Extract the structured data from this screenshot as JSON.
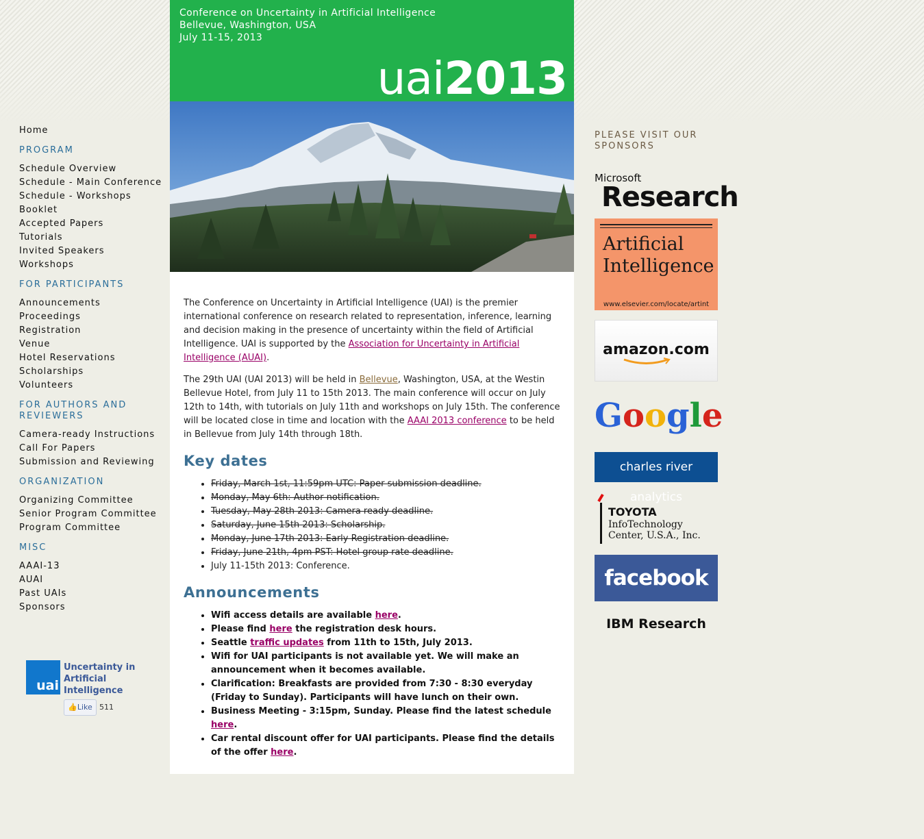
{
  "header": {
    "line1": "Conference on Uncertainty in Artificial Intelligence",
    "line2": "Bellevue, Washington, USA",
    "line3": "July 11-15, 2013",
    "logo_uai": "uai",
    "logo_year": "2013"
  },
  "nav": {
    "home": "Home",
    "program_head": "PROGRAM",
    "program_items": [
      "Schedule Overview",
      "Schedule - Main Conference",
      "Schedule - Workshops",
      "Booklet",
      "Accepted Papers",
      "Tutorials",
      "Invited Speakers",
      "Workshops"
    ],
    "participants_head": "FOR PARTICIPANTS",
    "participants_items": [
      "Announcements",
      "Proceedings",
      "Registration",
      "Venue",
      "Hotel Reservations",
      "Scholarships",
      "Volunteers"
    ],
    "authors_head": "FOR AUTHORS AND REVIEWERS",
    "authors_items": [
      "Camera-ready Instructions",
      "Call For Papers",
      "Submission and Reviewing"
    ],
    "organization_head": "ORGANIZATION",
    "organization_items": [
      "Organizing Committee",
      "Senior Program Committee",
      "Program Committee"
    ],
    "misc_head": "MISC",
    "misc_items": [
      "AAAI-13",
      "AUAI",
      "Past UAIs",
      "Sponsors"
    ]
  },
  "facebook": {
    "logo_text": "uai",
    "page_name": "Uncertainty in Artificial Intelligence",
    "like_label": "Like",
    "like_count": "511"
  },
  "intro": {
    "p1_text": "The Conference on Uncertainty in Artificial Intelligence (UAI) is the premier international conference on research related to representation, inference, learning and decision making in the presence of uncertainty within the field of Artificial Intelligence. UAI is supported by the ",
    "p1_link": "Association for Uncertainty in Artificial Intelligence (AUAI)",
    "p1_end": ".",
    "p2_a": "The 29th UAI (UAI 2013) will be held in ",
    "p2_link1": "Bellevue",
    "p2_b": ", Washington, USA, at the Westin Bellevue Hotel, from July 11 to 15th 2013. The main conference will occur on July 12th to 14th, with tutorials on July 11th and workshops on July 15th. The conference will be located close in time and location with the ",
    "p2_link2": "AAAI 2013 conference",
    "p2_c": " to be held in Bellevue from July 14th through 18th."
  },
  "key_dates": {
    "heading": "Key dates",
    "items": [
      {
        "text": "Friday, March 1st, 11:59pm UTC: Paper submission deadline.",
        "done": true
      },
      {
        "text": "Monday, May 6th: Author notification.",
        "done": true
      },
      {
        "text": "Tuesday, May 28th 2013: Camera ready deadline.",
        "done": true
      },
      {
        "text": "Saturday, June 15th 2013: Scholarship.",
        "done": true
      },
      {
        "text": "Monday, June 17th 2013: Early Registration deadline.",
        "done": true
      },
      {
        "text": "Friday, June 21th, 4pm PST: Hotel group rate deadline.",
        "done": true
      },
      {
        "text": "July 11-15th 2013: Conference.",
        "done": false
      }
    ]
  },
  "announcements": {
    "heading": "Announcements",
    "items": [
      {
        "before": "Wifi access details are available ",
        "link": "here",
        "after": "."
      },
      {
        "before": "Please find ",
        "link": "here",
        "after": " the registration desk hours."
      },
      {
        "before": "Seattle ",
        "link": "traffic updates",
        "after": " from 11th to 15th, July 2013."
      },
      {
        "before": "Wifi for UAI participants is not available yet. We will make an announcement when it becomes available.",
        "link": "",
        "after": ""
      },
      {
        "before": "Clarification: Breakfasts are provided from 7:30 - 8:30 everyday (Friday to Sunday). Participants will have lunch on their own.",
        "link": "",
        "after": ""
      },
      {
        "before": "Business Meeting - 3:15pm, Sunday. Please find the latest schedule ",
        "link": "here",
        "after": "."
      },
      {
        "before": "Car rental discount offer for UAI participants. Please find the details of the offer ",
        "link": "here",
        "after": "."
      }
    ]
  },
  "sponsors": {
    "heading": "PLEASE VISIT OUR SPONSORS",
    "microsoft_small": "Microsoft",
    "microsoft_big": "Research",
    "aij_line1": "Artificial",
    "aij_line2": "Intelligence",
    "aij_url": "www.elsevier.com/locate/artint",
    "amazon": "amazon.com",
    "google": [
      "G",
      "o",
      "o",
      "g",
      "l",
      "e"
    ],
    "cra": "charles river analytics",
    "toyota_line1": "TOYOTA",
    "toyota_line2": "InfoTechnology",
    "toyota_line3": "Center, U.S.A., Inc.",
    "facebook": "facebook",
    "ibm": "IBM Research"
  },
  "colors": {
    "header_green": "#22b14c",
    "nav_heading": "#2b6e9a",
    "link": "#990066",
    "h2": "#3d7093"
  }
}
